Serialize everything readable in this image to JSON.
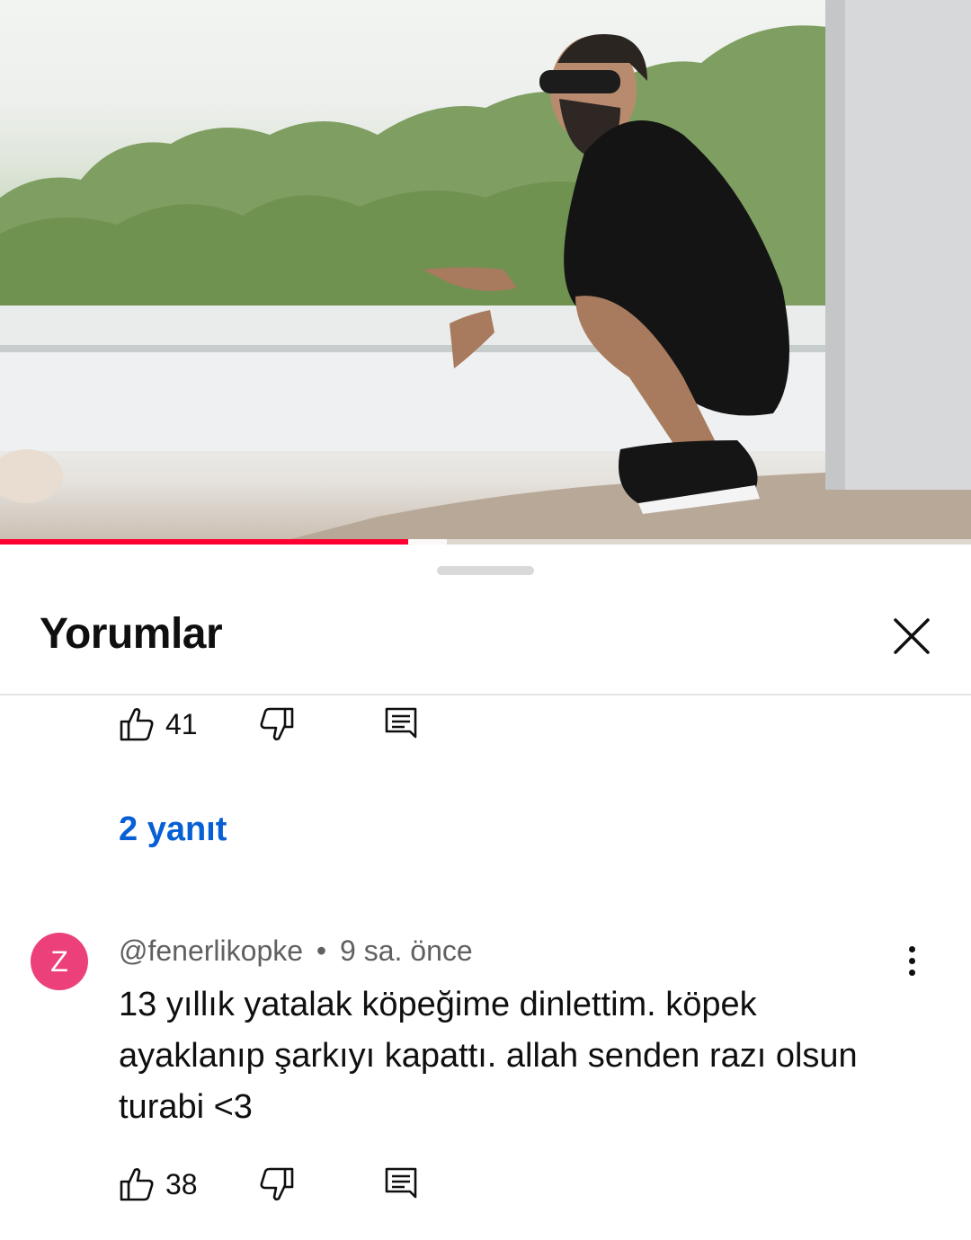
{
  "player": {
    "progress_percent": 42,
    "buffered_percent": 46,
    "progress_color": "#ff0033"
  },
  "sheet": {
    "title": "Yorumlar",
    "close_icon": "close-icon"
  },
  "previous_comment": {
    "likes": "41",
    "like_icon": "thumb-up-icon",
    "dislike_icon": "thumb-down-icon",
    "reply_icon": "reply-icon",
    "replies_label": "2 yanıt",
    "link_color": "#065fd4"
  },
  "comment": {
    "avatar_letter": "Z",
    "avatar_color": "#ec407a",
    "username": "@fenerlikopke",
    "separator": "•",
    "time": "9 sa. önce",
    "text": "13 yıllık yatalak köpeğime dinlettim. köpek ayaklanıp şarkıyı kapattı. allah senden razı olsun turabi <3",
    "likes": "38",
    "more_icon": "more-vert-icon"
  }
}
